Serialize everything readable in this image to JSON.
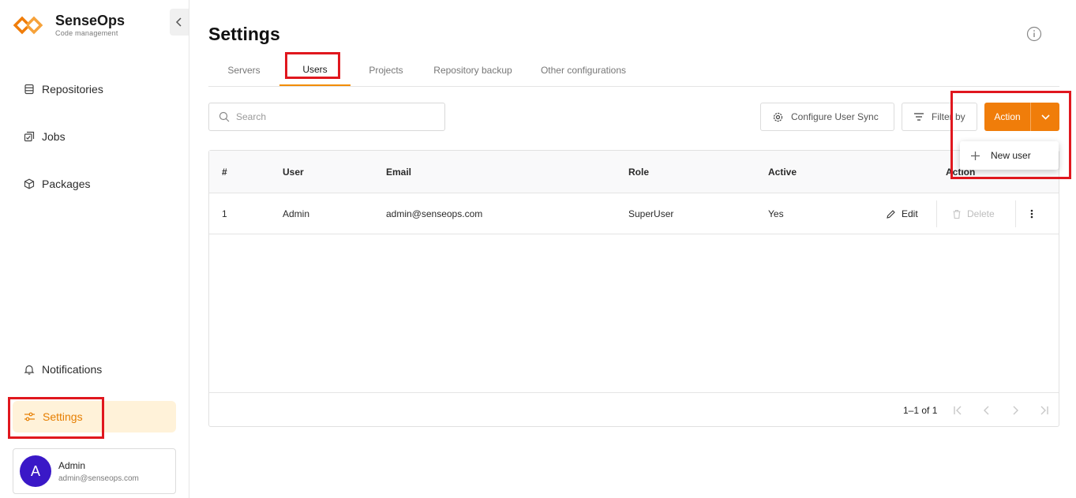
{
  "brand": {
    "name": "SenseOps",
    "tagline": "Code management"
  },
  "sidebar": {
    "items": [
      {
        "label": "Repositories",
        "icon": "database-icon"
      },
      {
        "label": "Jobs",
        "icon": "jobs-icon"
      },
      {
        "label": "Packages",
        "icon": "package-icon"
      }
    ],
    "notifications_label": "Notifications",
    "settings_label": "Settings",
    "user": {
      "initial": "A",
      "name": "Admin",
      "email": "admin@senseops.com"
    }
  },
  "page": {
    "title": "Settings"
  },
  "tabs": [
    {
      "label": "Servers"
    },
    {
      "label": "Users",
      "active": true
    },
    {
      "label": "Projects"
    },
    {
      "label": "Repository backup"
    },
    {
      "label": "Other configurations"
    }
  ],
  "toolbar": {
    "search_placeholder": "Search",
    "configure_sync_label": "Configure User Sync",
    "filter_label": "Filter by",
    "action_label": "Action"
  },
  "dropdown": {
    "new_user_label": "New user"
  },
  "table": {
    "headers": {
      "index": "#",
      "user": "User",
      "email": "Email",
      "role": "Role",
      "active": "Active",
      "action": "Action"
    },
    "rows": [
      {
        "index": "1",
        "user": "Admin",
        "email": "admin@senseops.com",
        "role": "SuperUser",
        "active": "Yes"
      }
    ],
    "edit_label": "Edit",
    "delete_label": "Delete",
    "pagination": "1–1 of 1"
  },
  "colors": {
    "accent": "#f07d0a",
    "active_bg": "#fff2d9",
    "highlight": "#e0171e",
    "avatar": "#3a18c7"
  }
}
